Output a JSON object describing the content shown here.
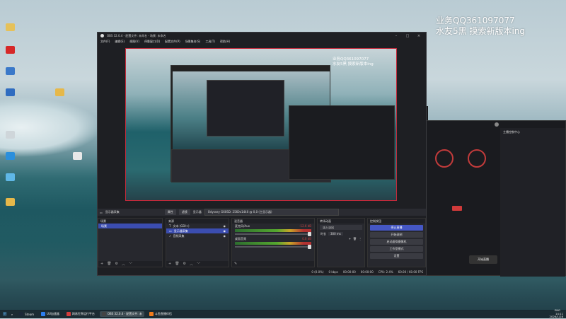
{
  "watermark": {
    "line1": "业务QQ361097077",
    "line2": "水友5黑 摸索新版本ing"
  },
  "desktop_icons": [
    {
      "label": "",
      "color": "#e6c15a"
    },
    {
      "label": "",
      "color": "#d62828"
    },
    {
      "label": "",
      "color": "#3b79c9"
    },
    {
      "label": "",
      "color": "#2f6cc0"
    },
    {
      "label": "",
      "color": "#e6b84a"
    },
    {
      "label": "",
      "color": "#cfd6da"
    },
    {
      "label": "",
      "color": "#2b8fdc"
    },
    {
      "label": "",
      "color": "#5fb7e6"
    },
    {
      "label": "",
      "color": "#e8e8e8"
    },
    {
      "label": "",
      "color": "#e6b84a"
    }
  ],
  "obs": {
    "title": "OBS 32.0.4 - 配置文件: 未命名 - 场景: 未命名",
    "menu": [
      "文件(F)",
      "编辑(E)",
      "视图(V)",
      "停靠窗口(D)",
      "配置文件(P)",
      "场景集合(S)",
      "工具(T)",
      "帮助(H)"
    ],
    "preview_watermark": {
      "line1": "业务QQ361097077",
      "line2": "水友5黑 摸索新版本ing"
    },
    "source_bar": {
      "label": "显示器采集",
      "props": "属性",
      "filters": "滤镜",
      "display_label": "显示器",
      "display_value": "Odyssey G60SD: 2560x1440 @ 0,0 (主显示器)"
    },
    "scenes": {
      "title": "场景",
      "items": [
        "场景"
      ]
    },
    "sources": {
      "title": "来源",
      "items": [
        "文本 (GDI+)",
        "显示器采集",
        "音频采集"
      ]
    },
    "mixer": {
      "title": "混音器",
      "channels": [
        {
          "name": "麦克风/Aux",
          "db": "-12.6 dB"
        },
        {
          "name": "桌面音频",
          "db": "0.0 dB"
        }
      ]
    },
    "transitions": {
      "title": "转场动画",
      "type": "淡入淡出",
      "duration_label": "时长",
      "duration": "300 ms"
    },
    "controls": {
      "title": "控制按钮",
      "buttons": [
        "停止直播",
        "开始录制",
        "启动虚拟摄像机",
        "工作室模式",
        "设置"
      ]
    },
    "status": {
      "items": [
        "0 (0.0%)",
        "0 kbps",
        "00:00:00",
        "00:00:00",
        "CPU: 2.4%",
        "60.00 / 60.00 FPS"
      ]
    }
  },
  "right_app": {
    "side_title": "主播控制中心",
    "button": "开始直播"
  },
  "taskbar": {
    "items": [
      {
        "label": "Steam",
        "color": "#1b2838"
      },
      {
        "label": "UU加速器",
        "color": "#2d7ff0"
      },
      {
        "label": "网易世界运行平台",
        "color": "#d23c3c"
      },
      {
        "label": "OBS 32.0.4 - 配置文件: 未",
        "color": "#444"
      },
      {
        "label": "斗鱼直播伴侣",
        "color": "#f07b1b"
      }
    ],
    "time": "14:11",
    "date": "2026/1/28",
    "lang": "ENG"
  }
}
